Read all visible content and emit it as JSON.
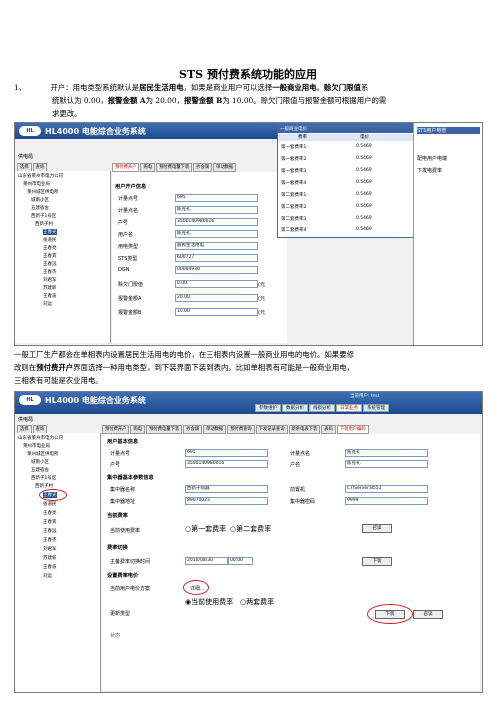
{
  "doc": {
    "title": "STS 预付费系统功能的应用",
    "item_num": "1、",
    "p1_pre": "开户：用电类型系统默认是",
    "p1_b1": "居民生活用电",
    "p1_mid1": "，如果是商业用户可以选择",
    "p1_b2": "一般商业用电",
    "p1_mid2": "。",
    "p1_b3": "赊欠门限值",
    "p1_mid3": "系",
    "p1_l2_pre": "统默认为 0.00，",
    "p1_b4": "报警金额 A",
    "p1_l2_mid": "为 20.00，",
    "p1_b5": "报警金额 B",
    "p1_l2_post": "为 10.00。赊欠门限值与报警金额可根据用户的需",
    "p1_l3": "求更改。",
    "p2_l1": "一般工厂生产都会在单相表内设置居民生活用电的电价，在三相表内设置一般商业用电的电价。如果要修",
    "p2_l2_pre": "改则在",
    "p2_b1": "预付费开户",
    "p2_l2_post": "界面选择一种用电类型，到下装界面下装到表内。比如单相表有可能是一般商业用电，",
    "p2_l3": "三相表有可能是农业用电。"
  },
  "app": {
    "logo": "HL",
    "title": "HL4000 电能综合业务系统",
    "user_label": "当前用户: test",
    "menus": [
      "参数维护",
      "数据分析",
      "线损分析",
      "日常业务",
      "系统管理"
    ],
    "office": "供电局",
    "tree_tabs": [
      "选择",
      "查询"
    ],
    "tree": [
      "山东省莱州市电力公司",
      "莱州市电业局",
      "莱州城区供电所",
      "城南小区",
      "五建宿舍",
      "西新子1号区",
      "西新子村",
      "王春光",
      "张道民",
      "王春亮",
      "王春宾",
      "王春远",
      "王春杰",
      "刘君军",
      "苏建新",
      "王春波",
      "刘运"
    ],
    "tabs1": [
      "预付费开户",
      "购电",
      "预付费电量下装",
      "抄会调",
      "单动数据",
      "预付费查询",
      "下发记录查询"
    ],
    "tabs2": [
      "预付费开户",
      "购电",
      "预付费电量下装",
      "抄会调",
      "单动数据",
      "预付费查询",
      "下发记录查询",
      "新余电表下装",
      "表码",
      "下装用户编码"
    ]
  },
  "shot1": {
    "section": "用户开户信息",
    "fields": [
      {
        "label": "计量点号",
        "value": "695"
      },
      {
        "label": "计量点名",
        "value": "陈克礼"
      },
      {
        "label": "户号",
        "value": "3500140980016"
      },
      {
        "label": "用户名",
        "value": "陈克礼"
      },
      {
        "label": "用电类型",
        "value": "居民生活用电"
      },
      {
        "label": "STS类型",
        "value": "600727"
      },
      {
        "label": "DGN",
        "value": "00004930"
      },
      {
        "label": "赊欠门限值",
        "value": "0.00"
      },
      {
        "label": "报警金额A",
        "value": "20.00"
      },
      {
        "label": "报警金额B",
        "value": "10.00"
      }
    ],
    "units": [
      "(元",
      "(元",
      "(元"
    ],
    "popup_title": "一般商业电价",
    "popup_head": [
      "费率",
      "电价"
    ],
    "rates": [
      {
        "name": "第一套费率1",
        "price": "0.5469"
      },
      {
        "name": "第一套费率2",
        "price": "0.5469"
      },
      {
        "name": "第一套费率3",
        "price": "0.5469"
      },
      {
        "name": "第一套费率4",
        "price": "0.5469"
      },
      {
        "name": "第二套费率1",
        "price": "0.5469"
      },
      {
        "name": "第二套费率2",
        "price": "0.5469"
      },
      {
        "name": "第二套费率3",
        "price": "0.5469"
      },
      {
        "name": "第二套费率4",
        "price": "0.5469"
      }
    ],
    "right_items": [
      "配电用户电端",
      "下发电费率"
    ],
    "right_header": "STS用户电管"
  },
  "shot2": {
    "sec_user": "用户基本信息",
    "jl_no_label": "计量点号",
    "jl_no": "695",
    "jl_name_label": "计量点名",
    "jl_name": "陈克礼",
    "hh_label": "户号",
    "hh": "3500140980016",
    "hm_label": "户名",
    "hm": "陈克礼",
    "sec_conc": "集中器基本参数信息",
    "conc_name_label": "集中器名称",
    "conc_name": "西新子际器",
    "conc_srv_label": "前置机",
    "conc_srv": "CTIServer.8551",
    "conc_addr_label": "集中器地址",
    "conc_addr": "89070023",
    "conc_pwd_label": "集中器密码",
    "conc_pwd": "9999",
    "sec_rate": "当前费率",
    "cur_rate_label": "当前使用费率",
    "radio1": "第一套费率",
    "radio2": "第二套费率",
    "read_btn": "召读",
    "sec_switch": "费率切换",
    "switch_label": "主备费率切换时间",
    "switch_date": "2010/08/30",
    "switch_time": "00:00",
    "download_btn": "下装",
    "sec_price": "设置费率电价",
    "scheme_label": "当前用户电价方案",
    "scheme_value": "详细...",
    "update_label": "更新类型",
    "upd1": "当前使用费率",
    "upd2": "两套费率",
    "download2_btn": "下装",
    "cancel_btn": "召读",
    "status_label": "状态"
  }
}
